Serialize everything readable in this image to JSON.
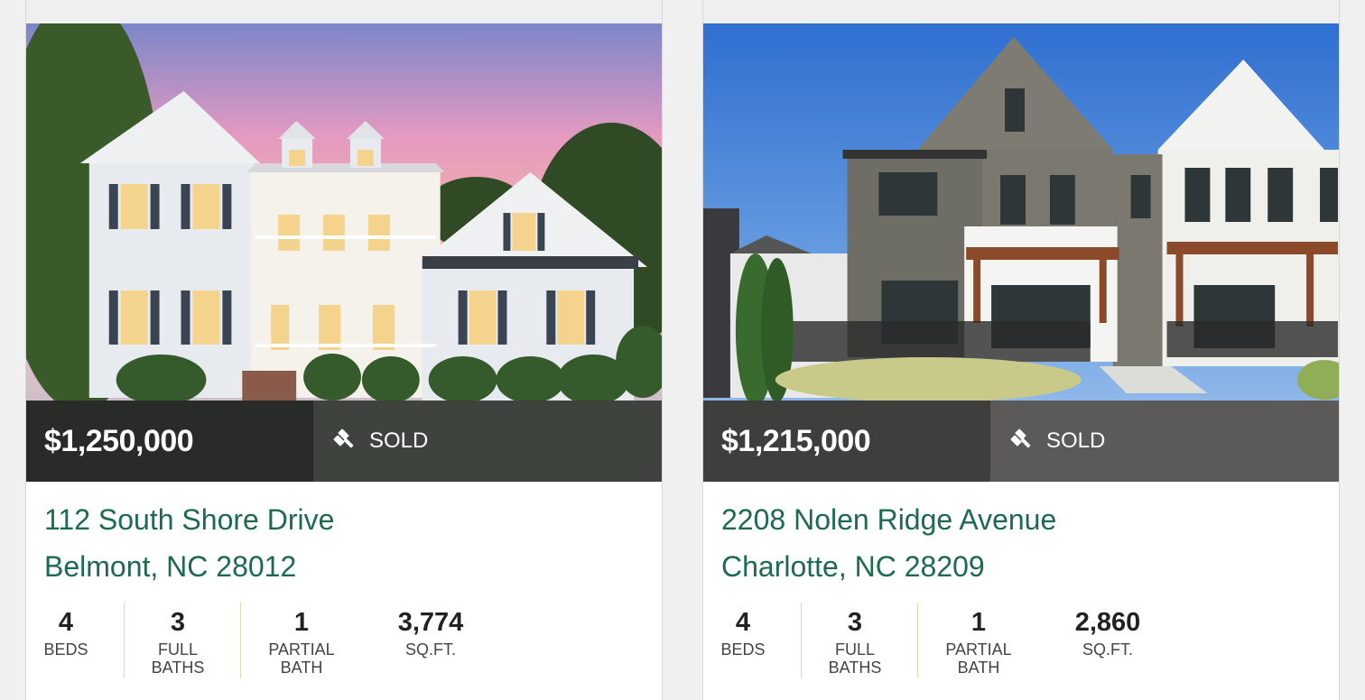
{
  "listings": [
    {
      "price": "$1,250,000",
      "status": "SOLD",
      "street": "112 South Shore Drive",
      "city": "Belmont, NC 28012",
      "stats": [
        {
          "value": "4",
          "label_1": "BEDS",
          "label_2": ""
        },
        {
          "value": "3",
          "label_1": "FULL",
          "label_2": "BATHS"
        },
        {
          "value": "1",
          "label_1": "PARTIAL",
          "label_2": "BATH"
        },
        {
          "value": "3,774",
          "label_1": "SQ.FT.",
          "label_2": ""
        }
      ]
    },
    {
      "price": "$1,215,000",
      "status": "SOLD",
      "street": "2208 Nolen Ridge Avenue",
      "city": "Charlotte, NC 28209",
      "stats": [
        {
          "value": "4",
          "label_1": "BEDS",
          "label_2": ""
        },
        {
          "value": "3",
          "label_1": "FULL",
          "label_2": "BATHS"
        },
        {
          "value": "1",
          "label_1": "PARTIAL",
          "label_2": "BATH"
        },
        {
          "value": "2,860",
          "label_1": "SQ.FT.",
          "label_2": ""
        }
      ]
    }
  ],
  "icons": {
    "status": "gavel-icon"
  },
  "colors": {
    "address": "#1e6a4f",
    "divider": "#e2d6b4"
  }
}
